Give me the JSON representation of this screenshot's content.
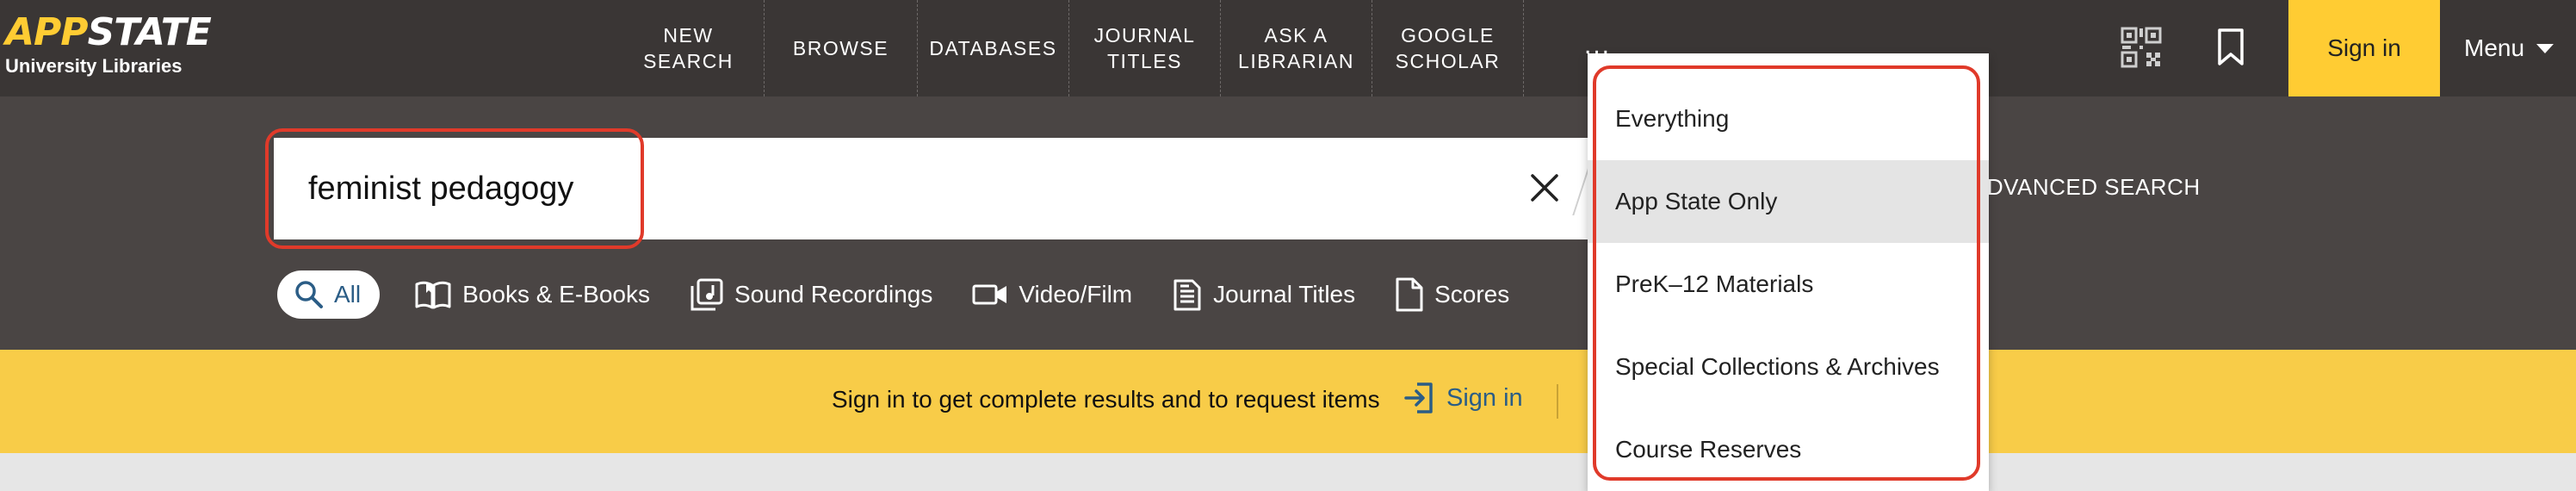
{
  "brand": {
    "logo_app": "APP",
    "logo_state": "STATE",
    "logo_sub": "University Libraries"
  },
  "nav": {
    "items": [
      {
        "line1": "NEW",
        "line2": "SEARCH"
      },
      {
        "line1": "BROWSE",
        "line2": ""
      },
      {
        "line1": "DATABASES",
        "line2": ""
      },
      {
        "line1": "JOURNAL",
        "line2": "TITLES"
      },
      {
        "line1": "ASK A",
        "line2": "LIBRARIAN"
      },
      {
        "line1": "GOOGLE",
        "line2": "SCHOLAR"
      }
    ],
    "more": "...",
    "signin": "Sign in",
    "menu": "Menu"
  },
  "search": {
    "value": "feminist pedagogy",
    "advanced": "ADVANCED SEARCH"
  },
  "filters": [
    {
      "label": "All",
      "icon": "search-icon"
    },
    {
      "label": "Books & E-Books",
      "icon": "book-icon"
    },
    {
      "label": "Sound Recordings",
      "icon": "music-icon"
    },
    {
      "label": "Video/Film",
      "icon": "video-icon"
    },
    {
      "label": "Journal Titles",
      "icon": "journal-icon"
    },
    {
      "label": "Scores",
      "icon": "document-icon"
    }
  ],
  "banner": {
    "text": "Sign in to get complete results and to request items",
    "signin": "Sign in"
  },
  "scope_dropdown": {
    "options": [
      "Everything",
      "App State Only",
      "PreK–12 Materials",
      "Special Collections & Archives",
      "Course Reserves"
    ],
    "selected": "App State Only"
  },
  "colors": {
    "brand_gold": "#ffcc33",
    "nav_bg": "#3a3635",
    "banner_bg": "#f8cc48",
    "link_blue": "#2b5d86",
    "highlight_red": "#e03a2a"
  }
}
